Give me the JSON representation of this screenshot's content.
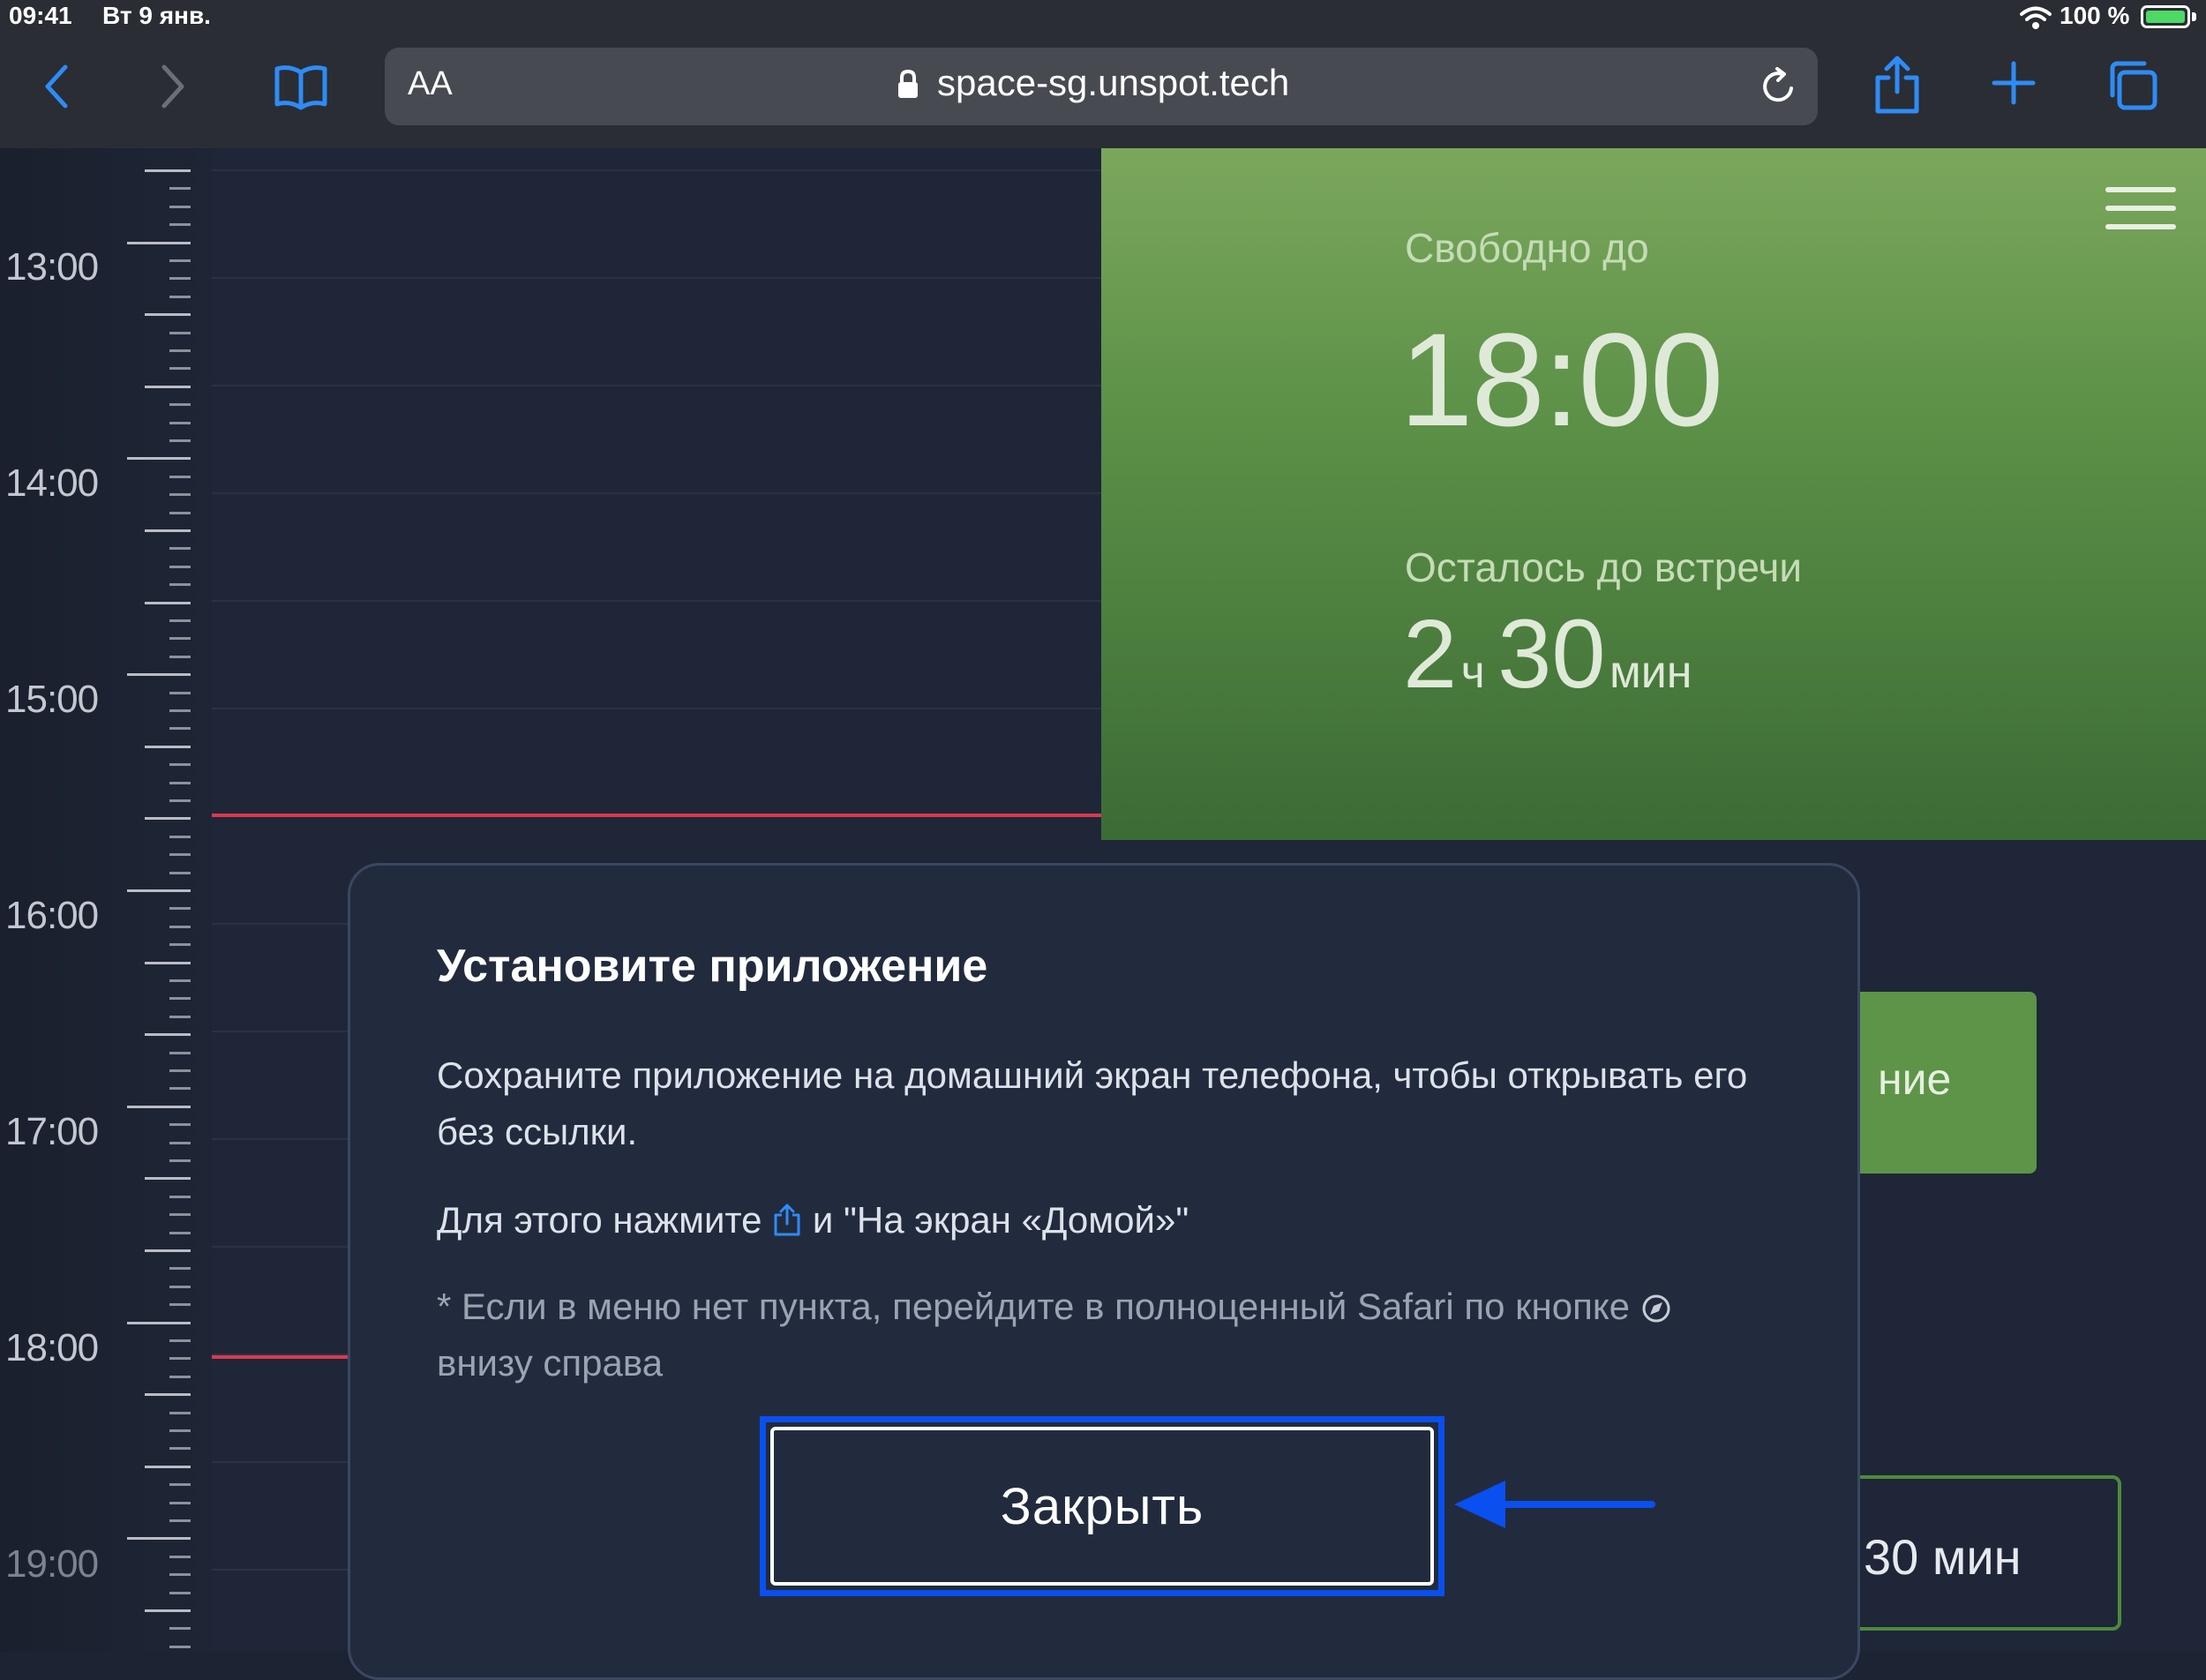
{
  "status_bar": {
    "time": "09:41",
    "date": "Вт 9 янв.",
    "battery_percent": "100 %",
    "battery_level": 1.0
  },
  "browser": {
    "text_size_label": "AA",
    "url": "space-sg.unspot.tech",
    "icons": [
      "back-icon",
      "forward-icon",
      "bookmarks-icon",
      "lock-icon",
      "reload-icon",
      "share-icon",
      "new-tab-icon",
      "tabs-icon"
    ],
    "accent_color": "#2e8cf6"
  },
  "timeline": {
    "hours": [
      "13:00",
      "14:00",
      "15:00",
      "16:00",
      "17:00",
      "18:00",
      "19:00"
    ]
  },
  "status_panel": {
    "free_until_label": "Свободно до",
    "free_until_time": "18:00",
    "remaining_label": "Осталось до встречи",
    "remaining_hours": "2",
    "hours_unit": "ч",
    "remaining_minutes": "30",
    "minutes_unit": "мин",
    "color": "#5b9047"
  },
  "background_buttons": {
    "book_partial": "ние",
    "duration_partial": "30 мин"
  },
  "modal": {
    "title": "Установите приложение",
    "paragraph1": "Сохраните приложение на домашний экран телефона, чтобы открывать его без ссылки.",
    "paragraph2_before": "Для этого нажмите",
    "paragraph2_after": "и \"На экран «Домой»\"",
    "note_before": "* Если в меню нет пункта, перейдите в полноценный Safari по кнопке",
    "note_after": "внизу справа",
    "close_label": "Закрыть"
  },
  "annotation": {
    "highlight_color": "#0a4ff0"
  }
}
